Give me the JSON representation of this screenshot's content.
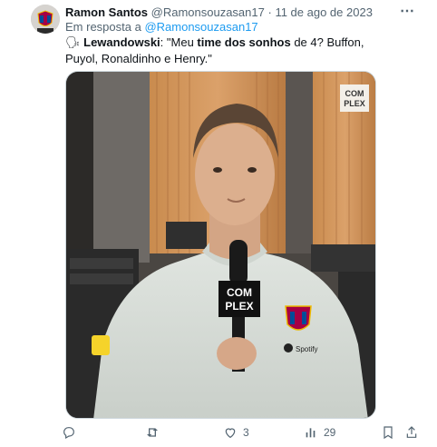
{
  "author": {
    "name": "Ramon Santos",
    "handle": "@Ramonsouzasan17",
    "separator": "·",
    "date": "11 de ago de 2023"
  },
  "reply": {
    "prefix": "Em resposta a",
    "mention": "@Ramonsouzasan17"
  },
  "text": {
    "emoji": "🗣",
    "speaker": "Lewandowski",
    "part1": ": \"Meu ",
    "bold_phrase": "time dos sonhos",
    "part2": " de 4? Buffon, Puyol, Ronaldinho e Henry.\""
  },
  "media": {
    "watermark_line1": "COM",
    "watermark_line2": "PLEX",
    "mic_line1": "COM",
    "mic_line2": "PLEX",
    "sponsor": "Spotify"
  },
  "actions": {
    "replies": "",
    "retweets": "",
    "likes": "3",
    "views": "29"
  },
  "colors": {
    "link": "#1d9bf0",
    "secondary": "#536471"
  }
}
